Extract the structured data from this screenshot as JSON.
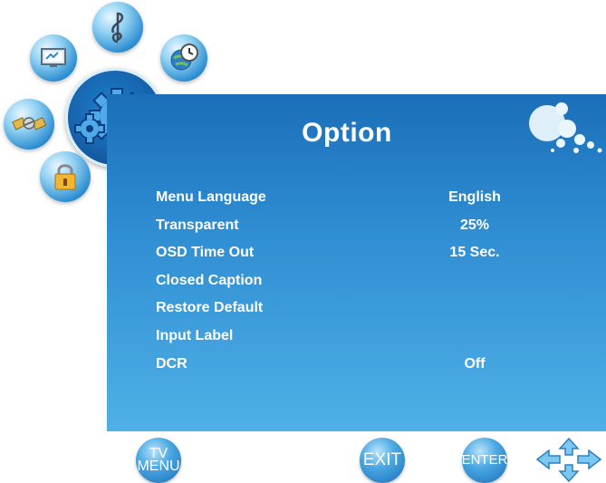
{
  "menu": {
    "title": "Option",
    "items": [
      {
        "label": "Menu Language",
        "value": "English"
      },
      {
        "label": "Transparent",
        "value": "25%"
      },
      {
        "label": "OSD Time Out",
        "value": "15 Sec."
      },
      {
        "label": "Closed Caption",
        "value": ""
      },
      {
        "label": "Restore Default",
        "value": ""
      },
      {
        "label": "Input Label",
        "value": ""
      },
      {
        "label": "DCR",
        "value": "Off"
      }
    ]
  },
  "side_icons": [
    "tv-picture-icon",
    "music-note-icon",
    "globe-clock-icon",
    "satellite-icon",
    "gear-icon",
    "lock-icon"
  ],
  "buttons": {
    "tv_menu_top": "TV",
    "tv_menu_bottom": "MENU",
    "exit": "EXIT",
    "enter": "ENTER"
  },
  "colors": {
    "panel_top": "#1a6fb8",
    "panel_bottom": "#4fb0e6",
    "text": "#ffffff"
  }
}
